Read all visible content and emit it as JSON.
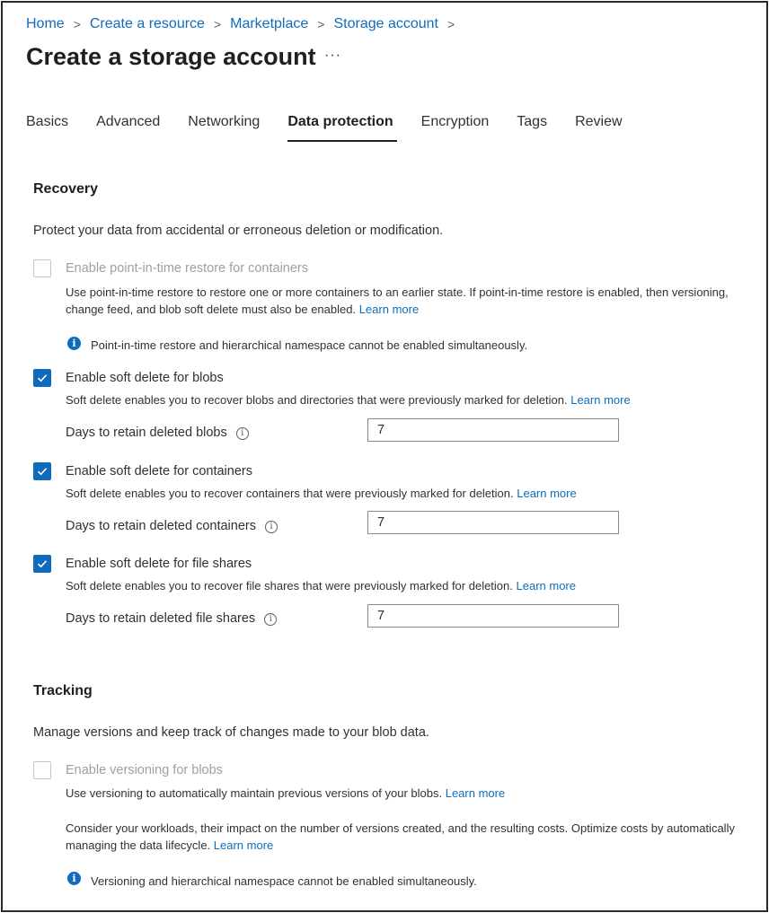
{
  "breadcrumb": [
    "Home",
    "Create a resource",
    "Marketplace",
    "Storage account"
  ],
  "page": {
    "title": "Create a storage account",
    "more": "···"
  },
  "tabs": [
    {
      "label": "Basics",
      "active": false
    },
    {
      "label": "Advanced",
      "active": false
    },
    {
      "label": "Networking",
      "active": false
    },
    {
      "label": "Data protection",
      "active": true
    },
    {
      "label": "Encryption",
      "active": false
    },
    {
      "label": "Tags",
      "active": false
    },
    {
      "label": "Review",
      "active": false
    }
  ],
  "recovery": {
    "heading": "Recovery",
    "description": "Protect your data from accidental or erroneous deletion or modification.",
    "pitr": {
      "label": "Enable point-in-time restore for containers",
      "checked": false,
      "disabled": true,
      "help": "Use point-in-time restore to restore one or more containers to an earlier state. If point-in-time restore is enabled, then versioning, change feed, and blob soft delete must also be enabled.",
      "learn_more": "Learn more",
      "info": "Point-in-time restore and hierarchical namespace cannot be enabled simultaneously."
    },
    "soft_delete_blobs": {
      "label": "Enable soft delete for blobs",
      "checked": true,
      "help": "Soft delete enables you to recover blobs and directories that were previously marked for deletion.",
      "learn_more": "Learn more",
      "days_label": "Days to retain deleted blobs",
      "days_value": "7"
    },
    "soft_delete_containers": {
      "label": "Enable soft delete for containers",
      "checked": true,
      "help": "Soft delete enables you to recover containers that were previously marked for deletion.",
      "learn_more": "Learn more",
      "days_label": "Days to retain deleted containers",
      "days_value": "7"
    },
    "soft_delete_shares": {
      "label": "Enable soft delete for file shares",
      "checked": true,
      "help": "Soft delete enables you to recover file shares that were previously marked for deletion.",
      "learn_more": "Learn more",
      "days_label": "Days to retain deleted file shares",
      "days_value": "7"
    }
  },
  "tracking": {
    "heading": "Tracking",
    "description": "Manage versions and keep track of changes made to your blob data.",
    "versioning": {
      "label": "Enable versioning for blobs",
      "checked": false,
      "disabled": true,
      "help": "Use versioning to automatically maintain previous versions of your blobs.",
      "learn_more": "Learn more",
      "note": "Consider your workloads, their impact on the number of versions created, and the resulting costs. Optimize costs by automatically managing the data lifecycle.",
      "note_learn_more": "Learn more",
      "info": "Versioning and hierarchical namespace cannot be enabled simultaneously."
    }
  },
  "colors": {
    "accent": "#0f6cbd",
    "text": "#323130",
    "disabled": "#a19f9d"
  },
  "icons": {
    "info": "info-circle-filled-icon",
    "tooltip": "info-circle-outline-icon",
    "check": "checkmark-icon"
  }
}
